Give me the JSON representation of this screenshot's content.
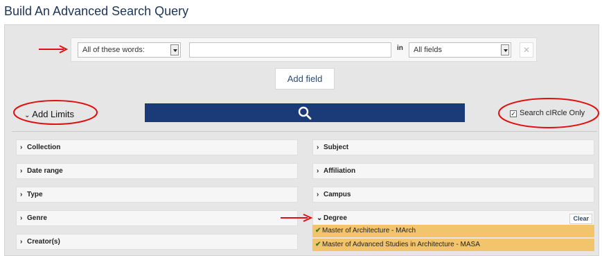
{
  "page": {
    "title": "Build An Advanced Search Query"
  },
  "search_row": {
    "match_select": {
      "value": "All of these words:"
    },
    "query_input": {
      "value": ""
    },
    "in_label": "in",
    "field_select": {
      "value": "All fields"
    },
    "remove_icon": "close-icon"
  },
  "add_field_label": "Add field",
  "limits": {
    "label": "Add Limits",
    "expanded": true
  },
  "search_button": {
    "icon": "search-icon",
    "color": "#1b3a78"
  },
  "circle_only": {
    "label": "Search cIRcle Only",
    "checked": true
  },
  "facets": {
    "left": [
      {
        "label": "Collection"
      },
      {
        "label": "Date range"
      },
      {
        "label": "Type"
      },
      {
        "label": "Genre"
      },
      {
        "label": "Creator(s)"
      }
    ],
    "right": [
      {
        "label": "Subject"
      },
      {
        "label": "Affiliation"
      },
      {
        "label": "Campus"
      },
      {
        "label": "Degree",
        "expanded": true,
        "clear_label": "Clear"
      }
    ]
  },
  "degree_selected": [
    {
      "label": "Master of Architecture - MArch"
    },
    {
      "label": "Master of Advanced Studies in Architecture - MASA"
    }
  ],
  "colors": {
    "selected_bg": "#f2c46c",
    "annotation": "#e01010",
    "title": "#1c3557"
  }
}
